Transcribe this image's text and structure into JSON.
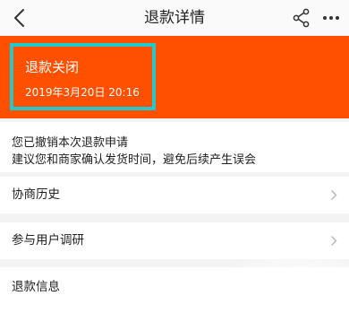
{
  "header": {
    "title": "退款详情",
    "back_icon": "chevron-left-icon",
    "share_icon": "share-icon",
    "more_icon": "more-dots-icon"
  },
  "status": {
    "title": "退款关闭",
    "time": "2019年3月20日 20:16",
    "banner_color": "#ff5000",
    "highlight_color": "#21c8cc"
  },
  "message": {
    "line1": "您已撤销本次退款申请",
    "line2": "建议您和商家确认发货时间，避免后续产生误会"
  },
  "rows": [
    {
      "label": "协商历史",
      "icon": "chevron-right-icon"
    },
    {
      "label": "参与用户调研",
      "icon": "chevron-right-icon"
    },
    {
      "label": "退款信息"
    }
  ]
}
